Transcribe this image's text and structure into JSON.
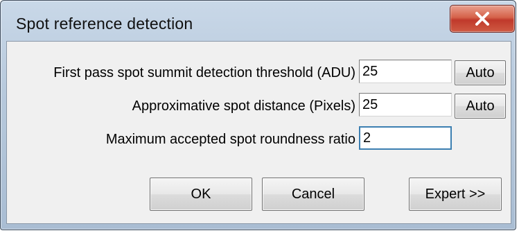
{
  "window": {
    "title": "Spot reference detection",
    "close_icon": "close-icon"
  },
  "fields": [
    {
      "label": "First pass spot summit detection threshold (ADU)",
      "value": "25",
      "button_label": "Auto"
    },
    {
      "label": "Approximative spot distance (Pixels)",
      "value": "25",
      "button_label": "Auto"
    },
    {
      "label": "Maximum accepted spot roundness ratio",
      "value": "2"
    }
  ],
  "buttons": {
    "ok_label": "OK",
    "cancel_label": "Cancel",
    "expert_label": "Expert >>"
  },
  "colors": {
    "close_button": "#c0392b",
    "titlebar": "#b7c9dc",
    "client": "#f0f0f0"
  }
}
